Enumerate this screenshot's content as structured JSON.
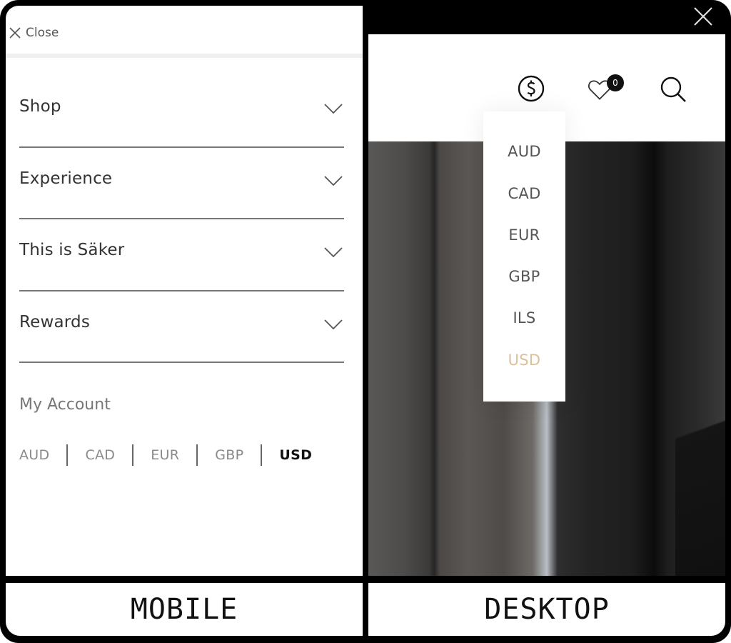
{
  "mobile": {
    "close_label": "Close",
    "menu": [
      {
        "label": "Shop"
      },
      {
        "label": "Experience"
      },
      {
        "label": "This is Säker"
      },
      {
        "label": "Rewards"
      }
    ],
    "account_label": "My Account",
    "currencies": [
      "AUD",
      "CAD",
      "EUR",
      "GBP",
      "USD"
    ],
    "selected_currency": "USD"
  },
  "desktop": {
    "icons": [
      "currency-icon",
      "wishlist-heart-icon",
      "search-icon"
    ],
    "wishlist_count": "0",
    "currency_dropdown": {
      "options": [
        "AUD",
        "CAD",
        "EUR",
        "GBP",
        "ILS",
        "USD"
      ],
      "selected": "USD",
      "selected_color": "#d9c29b"
    }
  },
  "labels": {
    "mobile": "MOBILE",
    "desktop": "DESKTOP"
  }
}
